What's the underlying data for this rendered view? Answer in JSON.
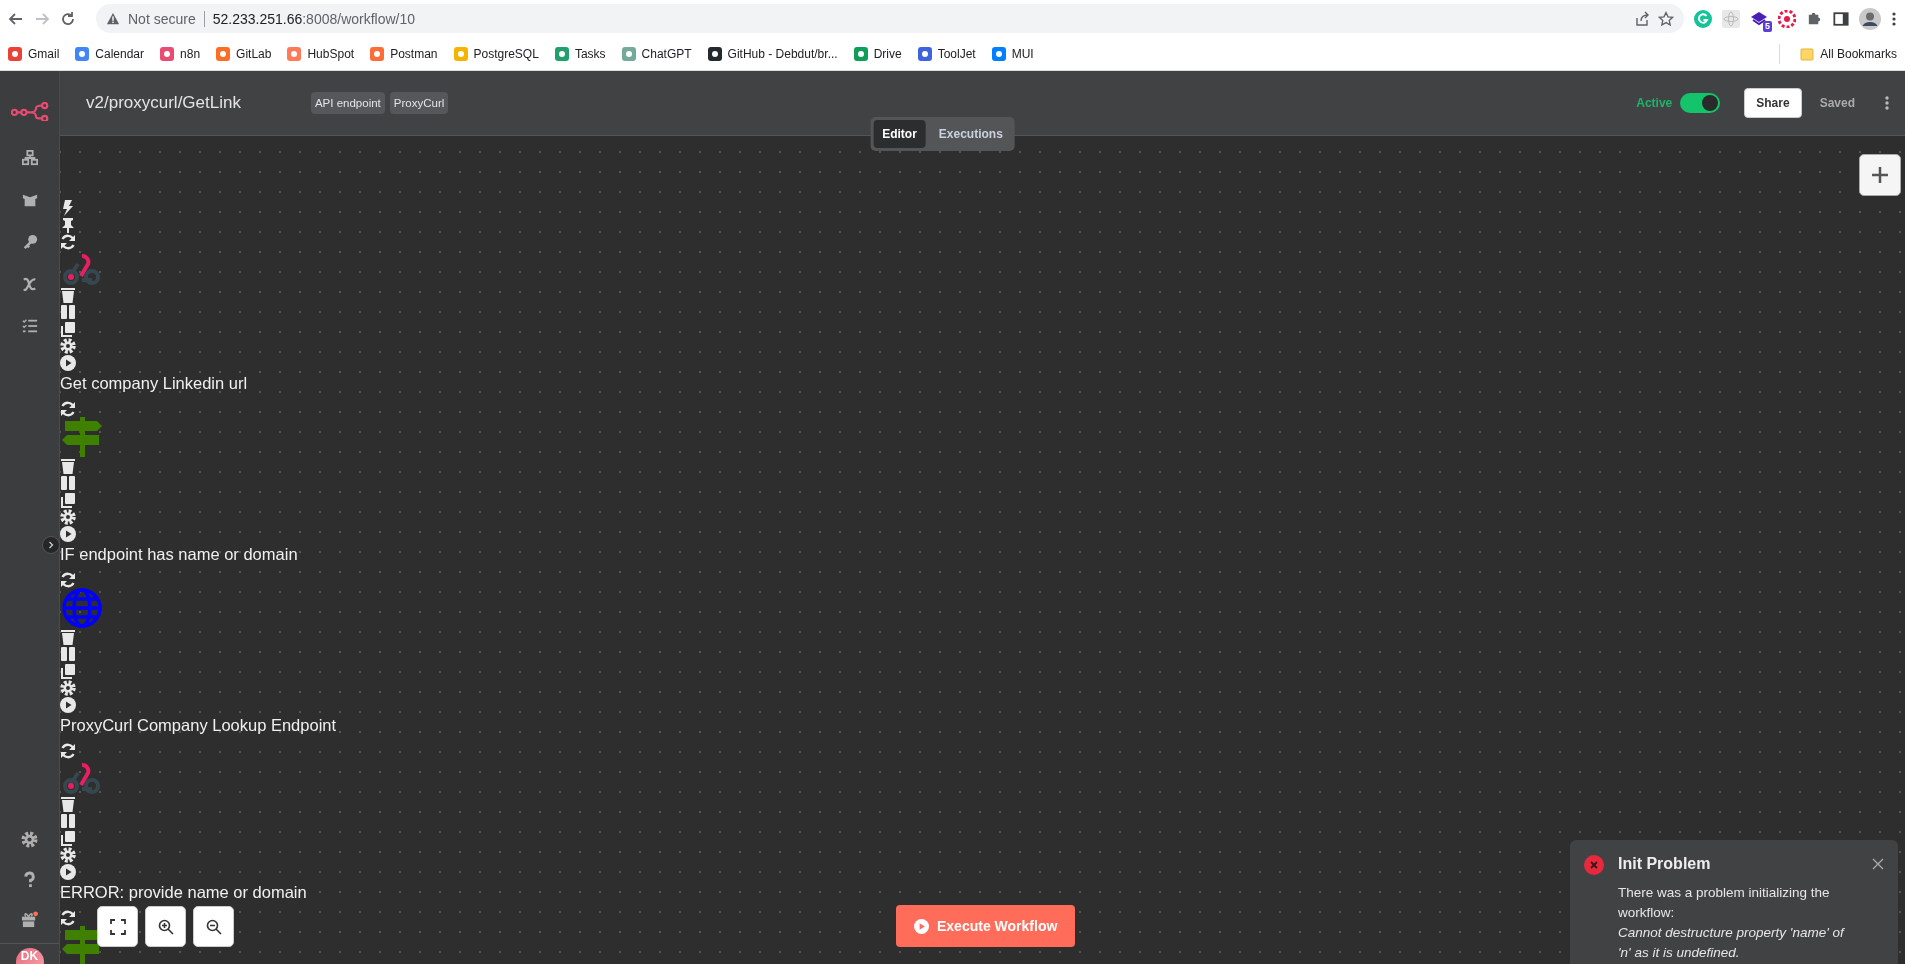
{
  "browser": {
    "security": "Not secure",
    "url_host": "52.233.251.66",
    "url_path": ":8008/workflow/10",
    "extension_badge": "5",
    "bookmarks": [
      {
        "label": "Gmail",
        "color": "#ea4335"
      },
      {
        "label": "Calendar",
        "color": "#4285f4"
      },
      {
        "label": "n8n",
        "color": "#ea4b71"
      },
      {
        "label": "GitLab",
        "color": "#fc6d26"
      },
      {
        "label": "HubSpot",
        "color": "#ff7a59"
      },
      {
        "label": "Postman",
        "color": "#ff6c37"
      },
      {
        "label": "PostgreSQL",
        "color": "#f4b400"
      },
      {
        "label": "Tasks",
        "color": "#22a06b"
      },
      {
        "label": "ChatGPT",
        "color": "#74aa9c"
      },
      {
        "label": "GitHub - Debdut/br...",
        "color": "#24292f"
      },
      {
        "label": "Drive",
        "color": "#0f9d58"
      },
      {
        "label": "ToolJet",
        "color": "#3e63dd"
      },
      {
        "label": "MUI",
        "color": "#007fff"
      }
    ],
    "all_bookmarks": "All Bookmarks"
  },
  "header": {
    "title": "v2/proxycurl/GetLink",
    "tags": [
      "API endpoint",
      "ProxyCurl"
    ],
    "active": {
      "label": "Active",
      "on": true
    },
    "share": "Share",
    "saved": "Saved",
    "tabs": [
      {
        "label": "Editor",
        "selected": true
      },
      {
        "label": "Executions",
        "selected": false
      }
    ]
  },
  "sidebar": {
    "avatar": "DK"
  },
  "canvas": {
    "nodes": [
      {
        "kind": "webhook",
        "trigger": true,
        "label": "Get company Linkedin url"
      },
      {
        "kind": "if",
        "trigger": false,
        "label": "IF endpoint has name or domain"
      },
      {
        "kind": "http",
        "trigger": false,
        "label": "ProxyCurl Company Lookup Endpoint"
      },
      {
        "kind": "webhook",
        "trigger": false,
        "label": "ERROR: provide name or domain"
      },
      {
        "kind": "if",
        "trigger": false
      }
    ],
    "execute": "Execute Workflow"
  },
  "toast": {
    "title": "Init Problem",
    "message": "There was a problem initializing the workflow:",
    "detail": "Cannot destructure property 'name' of 'n' as it is undefined."
  }
}
